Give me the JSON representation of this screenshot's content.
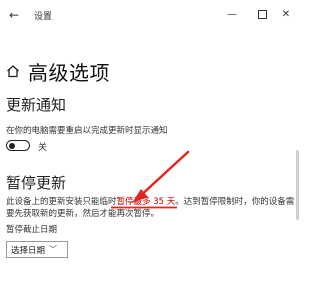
{
  "window": {
    "title": "设置",
    "back_glyph": "←",
    "min_glyph": "—",
    "close_glyph": "✕"
  },
  "page": {
    "title": "高级选项"
  },
  "update_notify": {
    "heading": "更新通知",
    "description": "在你的电脑需要重启以完成更新时显示通知",
    "toggle_state": "关"
  },
  "pause_updates": {
    "heading": "暂停更新",
    "para_part1": "此设备上的更新安装只能临时",
    "para_highlight": "暂停最多 35 天",
    "para_part2": "。达到暂停限制时，你的设备需要先获取新的更新，然后才能再次暂停。",
    "until_label": "暂停截止日期",
    "dropdown_value": "选择日期",
    "dropdown_chevron": "﹀"
  },
  "colors": {
    "annotation_red": "#e0271f",
    "accent_dark": "#222222"
  }
}
